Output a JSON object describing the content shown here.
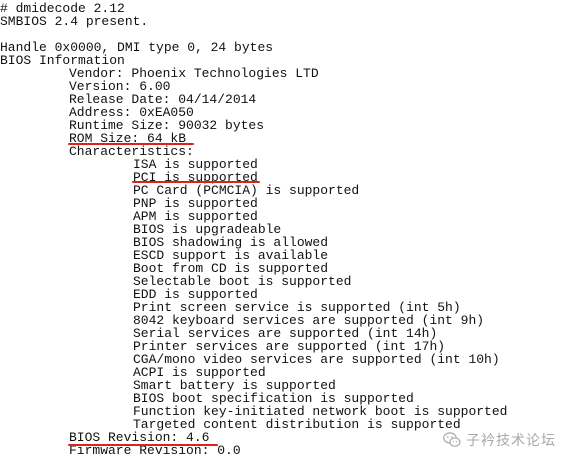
{
  "terminal": {
    "header": [
      "# dmidecode 2.12",
      "SMBIOS 2.4 present."
    ],
    "handle_line": "Handle 0x0000, DMI type 0, 24 bytes",
    "section_title": "BIOS Information",
    "fields": [
      "Vendor: Phoenix Technologies LTD",
      "Version: 6.00",
      "Release Date: 04/14/2014",
      "Address: 0xEA050",
      "Runtime Size: 90032 bytes",
      "ROM Size: 64 kB",
      "Characteristics:"
    ],
    "characteristics": [
      "ISA is supported",
      "PCI is supported",
      "PC Card (PCMCIA) is supported",
      "PNP is supported",
      "APM is supported",
      "BIOS is upgradeable",
      "BIOS shadowing is allowed",
      "ESCD support is available",
      "Boot from CD is supported",
      "Selectable boot is supported",
      "EDD is supported",
      "Print screen service is supported (int 5h)",
      "8042 keyboard services are supported (int 9h)",
      "Serial services are supported (int 14h)",
      "Printer services are supported (int 17h)",
      "CGA/mono video services are supported (int 10h)",
      "ACPI is supported",
      "Smart battery is supported",
      "BIOS boot specification is supported",
      "Function key-initiated network boot is supported",
      "Targeted content distribution is supported"
    ],
    "footer_fields": [
      "BIOS Revision: 4.6",
      "Firmware Revision: 0.0"
    ]
  },
  "highlight_color": "#d9241c",
  "watermark": {
    "icon": "wechat-logo-icon",
    "text": "子衿技术论坛"
  }
}
